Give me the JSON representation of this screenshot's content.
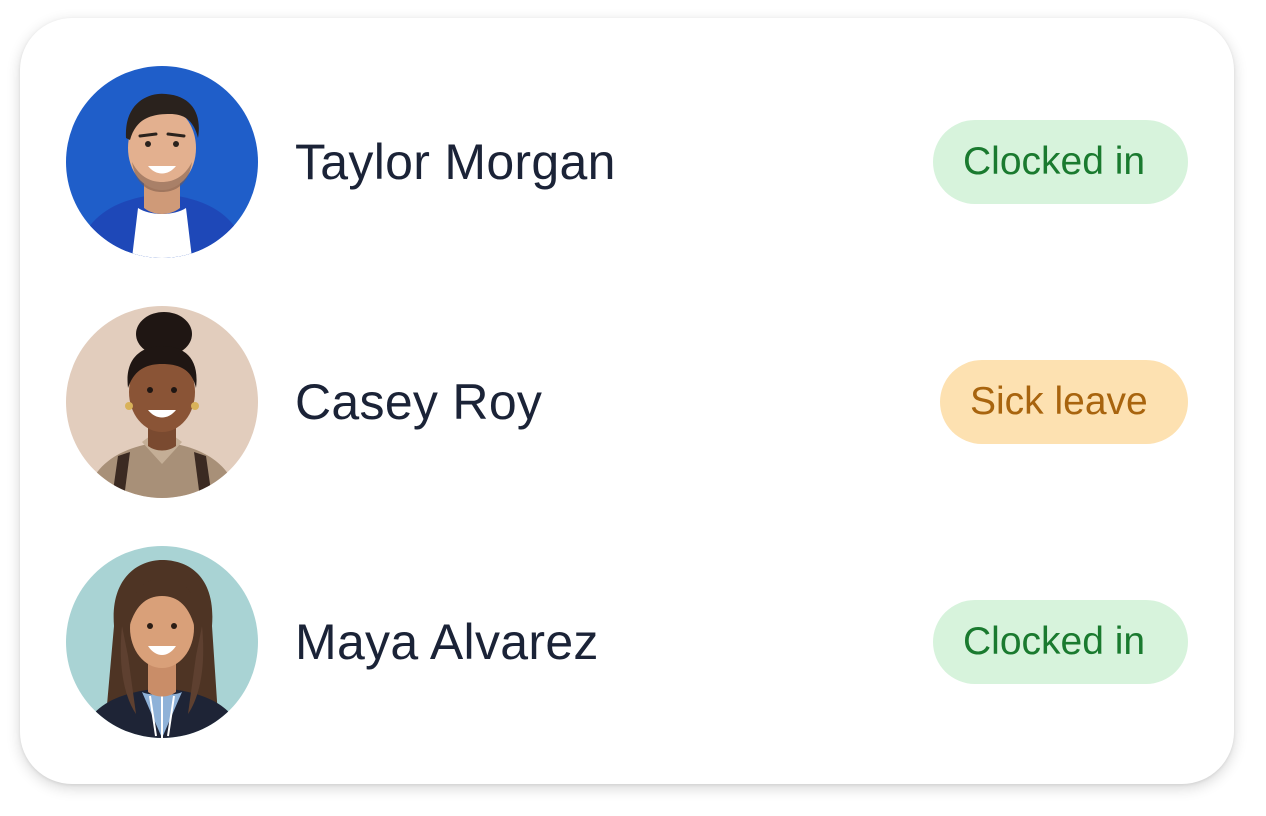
{
  "employees": [
    {
      "name": "Taylor Morgan",
      "status": "Clocked in",
      "status_type": "ok",
      "avatar": {
        "bg": "#1f5ec9",
        "skin": "#e3b08f",
        "hair": "#2a221d",
        "shirt": "#1e48b8",
        "inner": "#ffffff"
      }
    },
    {
      "name": "Casey Roy",
      "status": "Sick leave",
      "status_type": "sick",
      "avatar": {
        "bg": "#e2cdbd",
        "skin": "#8a5436",
        "hair": "#1f1613",
        "shirt": "#a89078",
        "inner": "#3b2a22"
      }
    },
    {
      "name": "Maya Alvarez",
      "status": "Clocked in",
      "status_type": "ok",
      "avatar": {
        "bg": "#a9d3d4",
        "skin": "#d9a079",
        "hair": "#4e3424",
        "shirt": "#1e2436",
        "inner": "#8fb2d8"
      }
    }
  ],
  "colors": {
    "clocked_in_bg": "#d7f3dc",
    "clocked_in_text": "#1a7a2f",
    "sick_leave_bg": "#fde1b1",
    "sick_leave_text": "#a8640e",
    "name_text": "#1b2337"
  }
}
